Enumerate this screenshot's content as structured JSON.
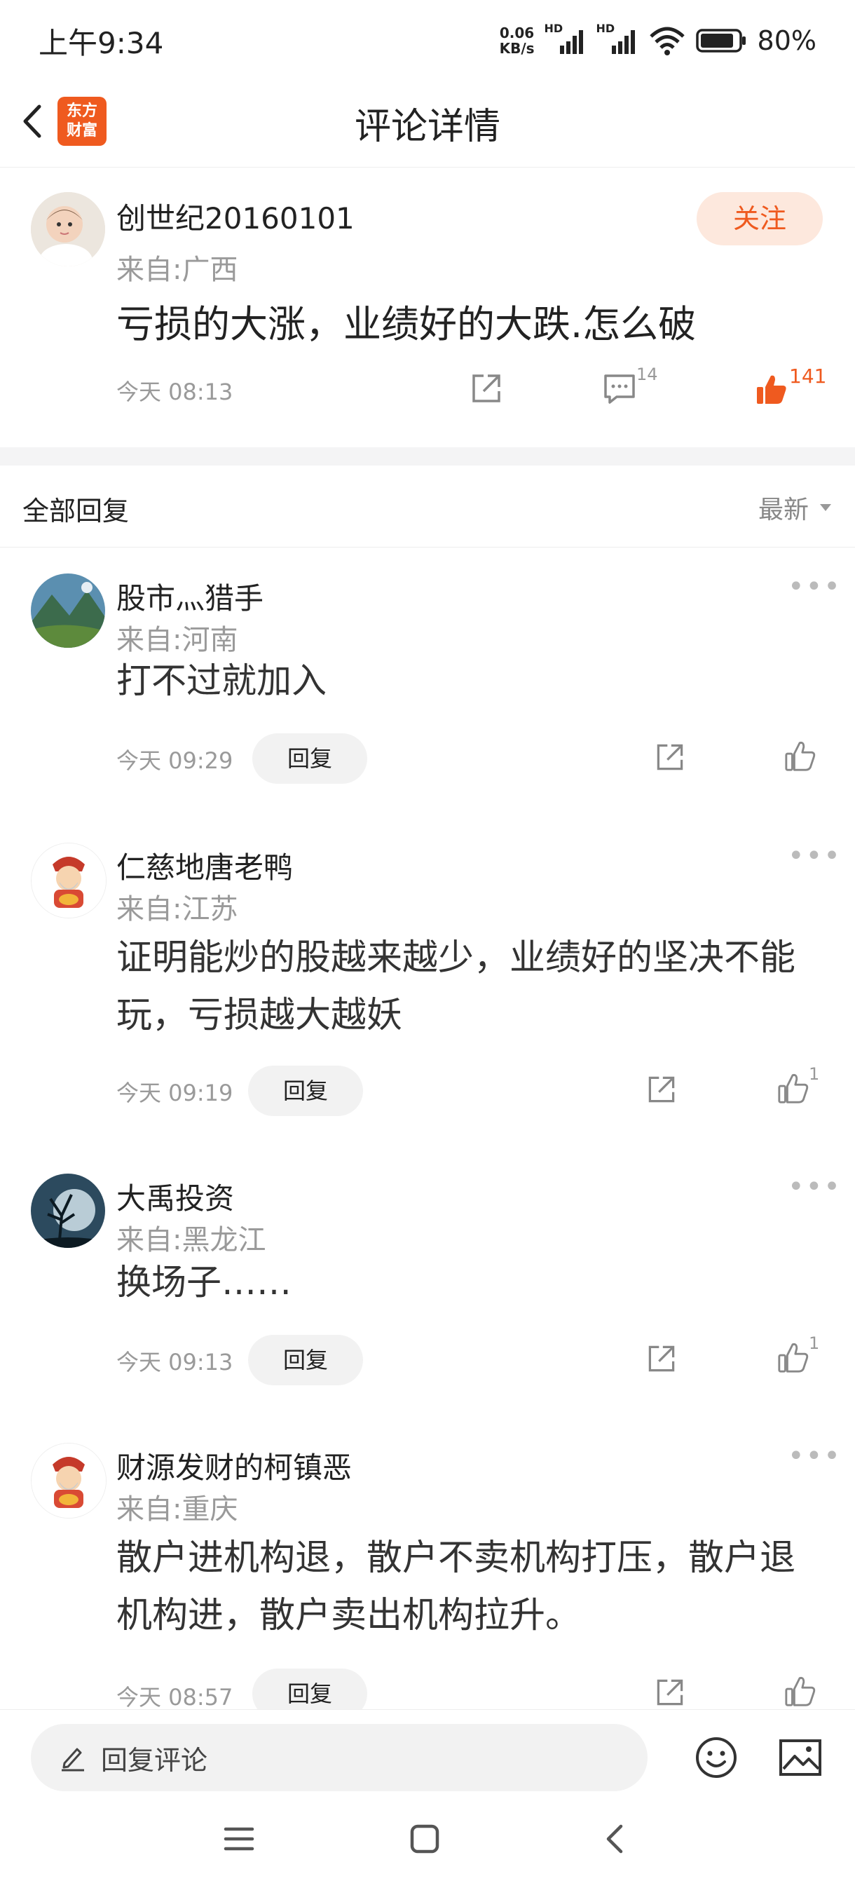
{
  "status_bar": {
    "time": "上午9:34",
    "net_speed_value": "0.06",
    "net_speed_unit": "KB/s",
    "hd1": "HD",
    "hd2": "HD",
    "battery": "80%"
  },
  "header": {
    "title": "评论详情",
    "logo_line1": "东方",
    "logo_line2": "财富"
  },
  "main_post": {
    "author": "创世纪20160101",
    "origin": "来自:广西",
    "follow_label": "关注",
    "content": "亏损的大涨，业绩好的大跌.怎么破",
    "time": "今天 08:13",
    "comment_count": "14",
    "like_count": "141"
  },
  "replies_section": {
    "title": "全部回复",
    "sort_label": "最新"
  },
  "replies": [
    {
      "author": "股市灬猎手",
      "origin": "来自:河南",
      "content": "打不过就加入",
      "time": "今天 09:29",
      "reply_label": "回复",
      "like_count": ""
    },
    {
      "author": "仁慈地唐老鸭",
      "origin": "来自:江苏",
      "content": "证明能炒的股越来越少，业绩好的坚决不能玩，亏损越大越妖",
      "time": "今天 09:19",
      "reply_label": "回复",
      "like_count": "1"
    },
    {
      "author": "大禹投资",
      "origin": "来自:黑龙江",
      "content": "换场子……",
      "time": "今天 09:13",
      "reply_label": "回复",
      "like_count": "1"
    },
    {
      "author": "财源发财的柯镇恶",
      "origin": "来自:重庆",
      "content": "散户进机构退，散户不卖机构打压，散户退机构进，散户卖出机构拉升。",
      "time": "今天 08:57",
      "reply_label": "回复",
      "like_count": ""
    }
  ],
  "bottom": {
    "input_placeholder": "回复评论"
  },
  "colors": {
    "accent": "#ef5a1f",
    "follow_bg": "#fde8dd",
    "muted": "#9a9a9a"
  }
}
